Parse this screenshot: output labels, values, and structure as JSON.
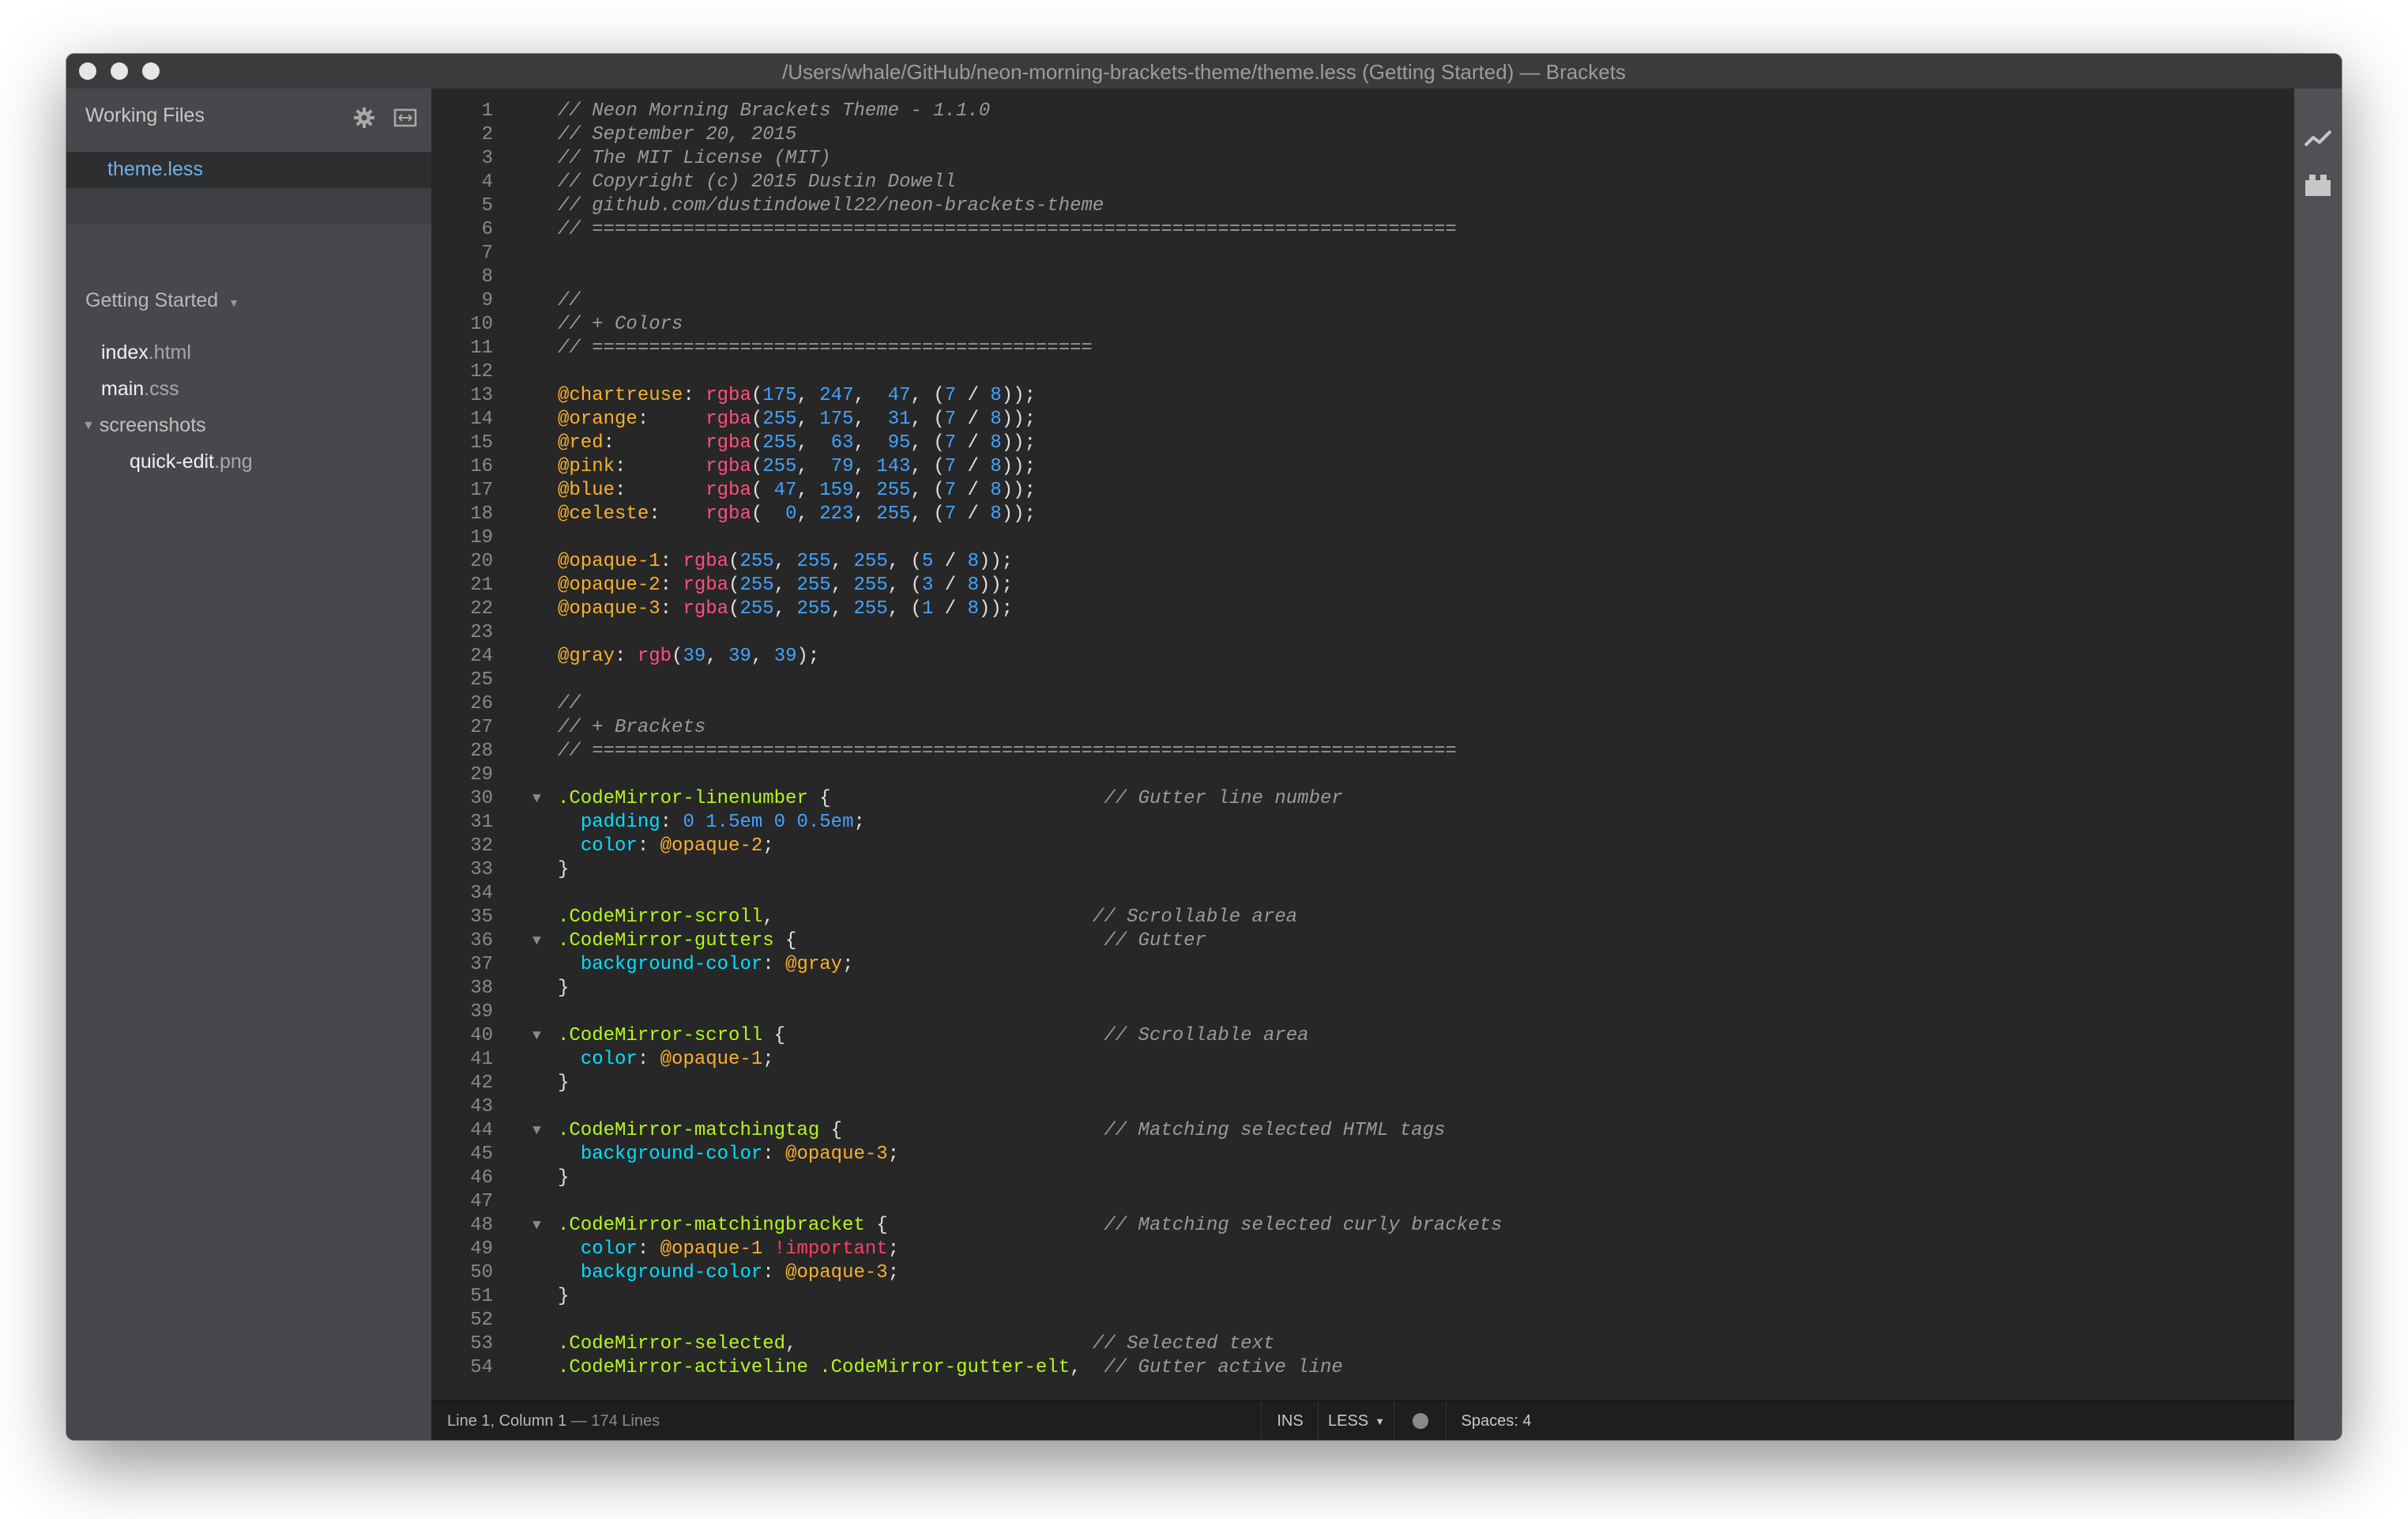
{
  "window": {
    "title": "/Users/whale/GitHub/neon-morning-brackets-theme/theme.less (Getting Started) — Brackets"
  },
  "sidebar": {
    "working_files_header": "Working Files",
    "working_files": [
      {
        "name": "theme.less"
      }
    ],
    "project_header": "Getting Started",
    "project_tree": [
      {
        "name": "index",
        "ext": ".html"
      },
      {
        "name": "main",
        "ext": ".css"
      },
      {
        "name": "screenshots",
        "ext": ""
      },
      {
        "name": "quick-edit",
        "ext": ".png"
      }
    ],
    "icons": [
      "gear-icon",
      "split-view-icon",
      "dropdown-arrow-icon",
      "folder-expanded-icon"
    ]
  },
  "right_toolbar": {
    "icons": [
      "live-preview-icon",
      "extension-manager-icon"
    ]
  },
  "editor": {
    "lines": [
      {
        "n": "1",
        "fold": "",
        "tokens": [
          [
            "c-comment",
            "// Neon Morning Brackets Theme - 1.1.0"
          ]
        ]
      },
      {
        "n": "2",
        "fold": "",
        "tokens": [
          [
            "c-comment",
            "// September 20, 2015"
          ]
        ]
      },
      {
        "n": "3",
        "fold": "",
        "tokens": [
          [
            "c-comment",
            "// The MIT License (MIT)"
          ]
        ]
      },
      {
        "n": "4",
        "fold": "",
        "tokens": [
          [
            "c-comment",
            "// Copyright (c) 2015 Dustin Dowell"
          ]
        ]
      },
      {
        "n": "5",
        "fold": "",
        "tokens": [
          [
            "c-comment",
            "// github.com/dustindowell22/neon-brackets-theme"
          ]
        ]
      },
      {
        "n": "6",
        "fold": "",
        "tokens": [
          [
            "c-comment",
            "// ============================================================================"
          ]
        ]
      },
      {
        "n": "7",
        "fold": "",
        "tokens": []
      },
      {
        "n": "8",
        "fold": "",
        "tokens": []
      },
      {
        "n": "9",
        "fold": "",
        "tokens": [
          [
            "c-comment",
            "//"
          ]
        ]
      },
      {
        "n": "10",
        "fold": "",
        "tokens": [
          [
            "c-comment",
            "// + Colors"
          ]
        ]
      },
      {
        "n": "11",
        "fold": "",
        "tokens": [
          [
            "c-comment",
            "// ============================================"
          ]
        ]
      },
      {
        "n": "12",
        "fold": "",
        "tokens": []
      },
      {
        "n": "13",
        "fold": "",
        "tokens": [
          [
            "c-var",
            "@chartreuse"
          ],
          [
            "",
            ": "
          ],
          [
            "c-fn",
            "rgba"
          ],
          [
            "",
            "("
          ],
          [
            "c-num",
            "175"
          ],
          [
            "",
            ", "
          ],
          [
            "c-num",
            "247"
          ],
          [
            "",
            ",  "
          ],
          [
            "c-num",
            "47"
          ],
          [
            "",
            ", ("
          ],
          [
            "c-num",
            "7"
          ],
          [
            "",
            " / "
          ],
          [
            "c-num",
            "8"
          ],
          [
            "",
            "));"
          ]
        ]
      },
      {
        "n": "14",
        "fold": "",
        "tokens": [
          [
            "c-var",
            "@orange"
          ],
          [
            "",
            ":     "
          ],
          [
            "c-fn",
            "rgba"
          ],
          [
            "",
            "("
          ],
          [
            "c-num",
            "255"
          ],
          [
            "",
            ", "
          ],
          [
            "c-num",
            "175"
          ],
          [
            "",
            ",  "
          ],
          [
            "c-num",
            "31"
          ],
          [
            "",
            ", ("
          ],
          [
            "c-num",
            "7"
          ],
          [
            "",
            " / "
          ],
          [
            "c-num",
            "8"
          ],
          [
            "",
            "));"
          ]
        ]
      },
      {
        "n": "15",
        "fold": "",
        "tokens": [
          [
            "c-var",
            "@red"
          ],
          [
            "",
            ":        "
          ],
          [
            "c-fn",
            "rgba"
          ],
          [
            "",
            "("
          ],
          [
            "c-num",
            "255"
          ],
          [
            "",
            ",  "
          ],
          [
            "c-num",
            "63"
          ],
          [
            "",
            ",  "
          ],
          [
            "c-num",
            "95"
          ],
          [
            "",
            ", ("
          ],
          [
            "c-num",
            "7"
          ],
          [
            "",
            " / "
          ],
          [
            "c-num",
            "8"
          ],
          [
            "",
            "));"
          ]
        ]
      },
      {
        "n": "16",
        "fold": "",
        "tokens": [
          [
            "c-var",
            "@pink"
          ],
          [
            "",
            ":       "
          ],
          [
            "c-fn",
            "rgba"
          ],
          [
            "",
            "("
          ],
          [
            "c-num",
            "255"
          ],
          [
            "",
            ",  "
          ],
          [
            "c-num",
            "79"
          ],
          [
            "",
            ", "
          ],
          [
            "c-num",
            "143"
          ],
          [
            "",
            ", ("
          ],
          [
            "c-num",
            "7"
          ],
          [
            "",
            " / "
          ],
          [
            "c-num",
            "8"
          ],
          [
            "",
            "));"
          ]
        ]
      },
      {
        "n": "17",
        "fold": "",
        "tokens": [
          [
            "c-var",
            "@blue"
          ],
          [
            "",
            ":       "
          ],
          [
            "c-fn",
            "rgba"
          ],
          [
            "",
            "( "
          ],
          [
            "c-num",
            "47"
          ],
          [
            "",
            ", "
          ],
          [
            "c-num",
            "159"
          ],
          [
            "",
            ", "
          ],
          [
            "c-num",
            "255"
          ],
          [
            "",
            ", ("
          ],
          [
            "c-num",
            "7"
          ],
          [
            "",
            " / "
          ],
          [
            "c-num",
            "8"
          ],
          [
            "",
            "));"
          ]
        ]
      },
      {
        "n": "18",
        "fold": "",
        "tokens": [
          [
            "c-var",
            "@celeste"
          ],
          [
            "",
            ":    "
          ],
          [
            "c-fn",
            "rgba"
          ],
          [
            "",
            "(  "
          ],
          [
            "c-num",
            "0"
          ],
          [
            "",
            ", "
          ],
          [
            "c-num",
            "223"
          ],
          [
            "",
            ", "
          ],
          [
            "c-num",
            "255"
          ],
          [
            "",
            ", ("
          ],
          [
            "c-num",
            "7"
          ],
          [
            "",
            " / "
          ],
          [
            "c-num",
            "8"
          ],
          [
            "",
            "));"
          ]
        ]
      },
      {
        "n": "19",
        "fold": "",
        "tokens": []
      },
      {
        "n": "20",
        "fold": "",
        "tokens": [
          [
            "c-var",
            "@opaque-1"
          ],
          [
            "",
            ": "
          ],
          [
            "c-fn",
            "rgba"
          ],
          [
            "",
            "("
          ],
          [
            "c-num",
            "255"
          ],
          [
            "",
            ", "
          ],
          [
            "c-num",
            "255"
          ],
          [
            "",
            ", "
          ],
          [
            "c-num",
            "255"
          ],
          [
            "",
            ", ("
          ],
          [
            "c-num",
            "5"
          ],
          [
            "",
            " / "
          ],
          [
            "c-num",
            "8"
          ],
          [
            "",
            "));"
          ]
        ]
      },
      {
        "n": "21",
        "fold": "",
        "tokens": [
          [
            "c-var",
            "@opaque-2"
          ],
          [
            "",
            ": "
          ],
          [
            "c-fn",
            "rgba"
          ],
          [
            "",
            "("
          ],
          [
            "c-num",
            "255"
          ],
          [
            "",
            ", "
          ],
          [
            "c-num",
            "255"
          ],
          [
            "",
            ", "
          ],
          [
            "c-num",
            "255"
          ],
          [
            "",
            ", ("
          ],
          [
            "c-num",
            "3"
          ],
          [
            "",
            " / "
          ],
          [
            "c-num",
            "8"
          ],
          [
            "",
            "));"
          ]
        ]
      },
      {
        "n": "22",
        "fold": "",
        "tokens": [
          [
            "c-var",
            "@opaque-3"
          ],
          [
            "",
            ": "
          ],
          [
            "c-fn",
            "rgba"
          ],
          [
            "",
            "("
          ],
          [
            "c-num",
            "255"
          ],
          [
            "",
            ", "
          ],
          [
            "c-num",
            "255"
          ],
          [
            "",
            ", "
          ],
          [
            "c-num",
            "255"
          ],
          [
            "",
            ", ("
          ],
          [
            "c-num",
            "1"
          ],
          [
            "",
            " / "
          ],
          [
            "c-num",
            "8"
          ],
          [
            "",
            "));"
          ]
        ]
      },
      {
        "n": "23",
        "fold": "",
        "tokens": []
      },
      {
        "n": "24",
        "fold": "",
        "tokens": [
          [
            "c-var",
            "@gray"
          ],
          [
            "",
            ": "
          ],
          [
            "c-fn",
            "rgb"
          ],
          [
            "",
            "("
          ],
          [
            "c-num",
            "39"
          ],
          [
            "",
            ", "
          ],
          [
            "c-num",
            "39"
          ],
          [
            "",
            ", "
          ],
          [
            "c-num",
            "39"
          ],
          [
            "",
            ");"
          ]
        ]
      },
      {
        "n": "25",
        "fold": "",
        "tokens": []
      },
      {
        "n": "26",
        "fold": "",
        "tokens": [
          [
            "c-comment",
            "//"
          ]
        ]
      },
      {
        "n": "27",
        "fold": "",
        "tokens": [
          [
            "c-comment",
            "// + Brackets"
          ]
        ]
      },
      {
        "n": "28",
        "fold": "",
        "tokens": [
          [
            "c-comment",
            "// ============================================================================"
          ]
        ]
      },
      {
        "n": "29",
        "fold": "",
        "tokens": []
      },
      {
        "n": "30",
        "fold": "▼",
        "tokens": [
          [
            "c-sel",
            ".CodeMirror-linenumber"
          ],
          [
            "",
            " {                        "
          ],
          [
            "c-comment",
            "// Gutter line number"
          ]
        ]
      },
      {
        "n": "31",
        "fold": "",
        "tokens": [
          [
            "",
            "  "
          ],
          [
            "c-prop",
            "padding"
          ],
          [
            "",
            ": "
          ],
          [
            "c-num",
            "0 1.5em 0 0.5em"
          ],
          [
            "",
            ";"
          ]
        ]
      },
      {
        "n": "32",
        "fold": "",
        "tokens": [
          [
            "",
            "  "
          ],
          [
            "c-prop",
            "color"
          ],
          [
            "",
            ": "
          ],
          [
            "c-var",
            "@opaque-2"
          ],
          [
            "",
            ";"
          ]
        ]
      },
      {
        "n": "33",
        "fold": "",
        "tokens": [
          [
            "",
            "}"
          ]
        ]
      },
      {
        "n": "34",
        "fold": "",
        "tokens": []
      },
      {
        "n": "35",
        "fold": "",
        "tokens": [
          [
            "c-sel",
            ".CodeMirror-scroll"
          ],
          [
            "",
            ",                            "
          ],
          [
            "c-comment",
            "// Scrollable area"
          ]
        ]
      },
      {
        "n": "36",
        "fold": "▼",
        "tokens": [
          [
            "c-sel",
            ".CodeMirror-gutters"
          ],
          [
            "",
            " {                           "
          ],
          [
            "c-comment",
            "// Gutter"
          ]
        ]
      },
      {
        "n": "37",
        "fold": "",
        "tokens": [
          [
            "",
            "  "
          ],
          [
            "c-prop",
            "background-color"
          ],
          [
            "",
            ": "
          ],
          [
            "c-var",
            "@gray"
          ],
          [
            "",
            ";"
          ]
        ]
      },
      {
        "n": "38",
        "fold": "",
        "tokens": [
          [
            "",
            "}"
          ]
        ]
      },
      {
        "n": "39",
        "fold": "",
        "tokens": []
      },
      {
        "n": "40",
        "fold": "▼",
        "tokens": [
          [
            "c-sel",
            ".CodeMirror-scroll"
          ],
          [
            "",
            " {                            "
          ],
          [
            "c-comment",
            "// Scrollable area"
          ]
        ]
      },
      {
        "n": "41",
        "fold": "",
        "tokens": [
          [
            "",
            "  "
          ],
          [
            "c-prop",
            "color"
          ],
          [
            "",
            ": "
          ],
          [
            "c-var",
            "@opaque-1"
          ],
          [
            "",
            ";"
          ]
        ]
      },
      {
        "n": "42",
        "fold": "",
        "tokens": [
          [
            "",
            "}"
          ]
        ]
      },
      {
        "n": "43",
        "fold": "",
        "tokens": []
      },
      {
        "n": "44",
        "fold": "▼",
        "tokens": [
          [
            "c-sel",
            ".CodeMirror-matchingtag"
          ],
          [
            "",
            " {                       "
          ],
          [
            "c-comment",
            "// Matching selected HTML tags"
          ]
        ]
      },
      {
        "n": "45",
        "fold": "",
        "tokens": [
          [
            "",
            "  "
          ],
          [
            "c-prop",
            "background-color"
          ],
          [
            "",
            ": "
          ],
          [
            "c-var",
            "@opaque-3"
          ],
          [
            "",
            ";"
          ]
        ]
      },
      {
        "n": "46",
        "fold": "",
        "tokens": [
          [
            "",
            "}"
          ]
        ]
      },
      {
        "n": "47",
        "fold": "",
        "tokens": []
      },
      {
        "n": "48",
        "fold": "▼",
        "tokens": [
          [
            "c-sel",
            ".CodeMirror-matchingbracket"
          ],
          [
            "",
            " {                   "
          ],
          [
            "c-comment",
            "// Matching selected curly brackets"
          ]
        ]
      },
      {
        "n": "49",
        "fold": "",
        "tokens": [
          [
            "",
            "  "
          ],
          [
            "c-prop",
            "color"
          ],
          [
            "",
            ": "
          ],
          [
            "c-var",
            "@opaque-1"
          ],
          [
            "",
            " "
          ],
          [
            "c-imp",
            "!important"
          ],
          [
            "",
            ";"
          ]
        ]
      },
      {
        "n": "50",
        "fold": "",
        "tokens": [
          [
            "",
            "  "
          ],
          [
            "c-prop",
            "background-color"
          ],
          [
            "",
            ": "
          ],
          [
            "c-var",
            "@opaque-3"
          ],
          [
            "",
            ";"
          ]
        ]
      },
      {
        "n": "51",
        "fold": "",
        "tokens": [
          [
            "",
            "}"
          ]
        ]
      },
      {
        "n": "52",
        "fold": "",
        "tokens": []
      },
      {
        "n": "53",
        "fold": "",
        "tokens": [
          [
            "c-sel",
            ".CodeMirror-selected"
          ],
          [
            "",
            ",                          "
          ],
          [
            "c-comment",
            "// Selected text"
          ]
        ]
      },
      {
        "n": "54",
        "fold": "",
        "tokens": [
          [
            "c-sel",
            ".CodeMirror-activeline .CodeMirror-gutter-elt"
          ],
          [
            "",
            ",  "
          ],
          [
            "c-comment",
            "// Gutter active line"
          ]
        ]
      }
    ]
  },
  "statusbar": {
    "position": "Line 1, Column 1",
    "line_count": "174 Lines",
    "ins": "INS",
    "language": "LESS",
    "spaces": "Spaces: 4"
  },
  "colors": {
    "editor_bg": "#272727",
    "comment": "#9a9a9a",
    "variable": "#f8b030",
    "function": "#ff4f7f",
    "number": "#43a3ff",
    "selector": "#b5f71f",
    "property": "#00dfff"
  }
}
